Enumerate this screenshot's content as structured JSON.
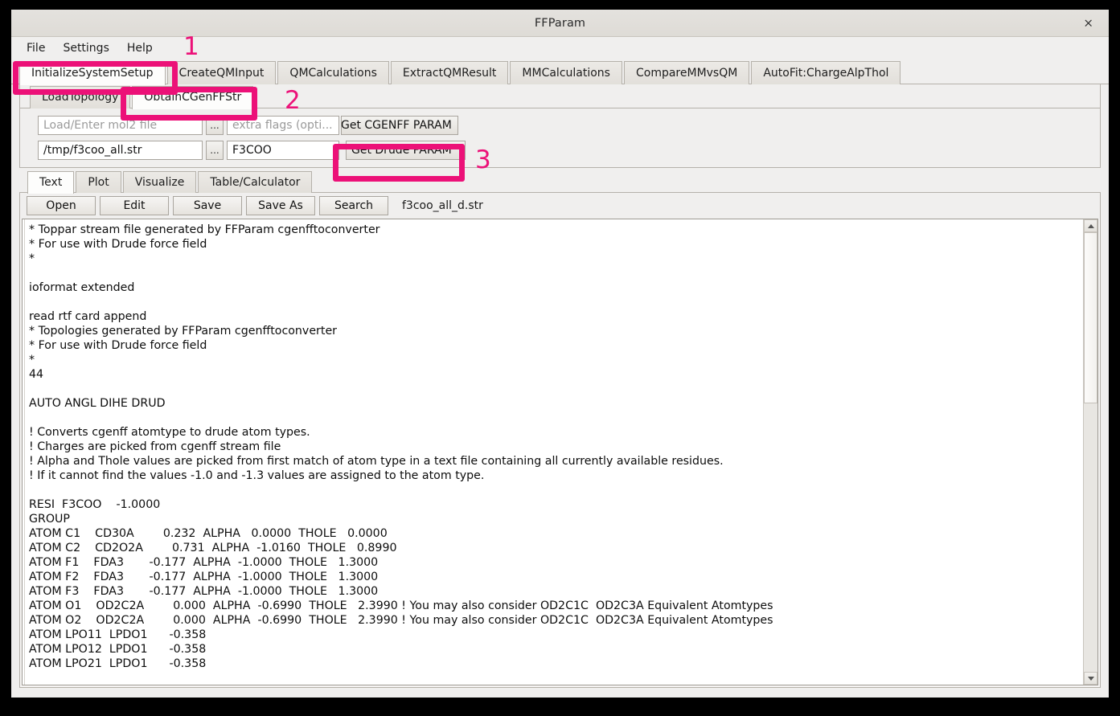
{
  "window": {
    "title": "FFParam",
    "close_label": "×"
  },
  "menubar": {
    "items": [
      {
        "label": "File"
      },
      {
        "label": "Settings"
      },
      {
        "label": "Help"
      }
    ]
  },
  "main_tabs": {
    "active": "InitializeSystemSetup",
    "items": [
      {
        "label": "InitializeSystemSetup"
      },
      {
        "label": "CreateQMInput"
      },
      {
        "label": "QMCalculations"
      },
      {
        "label": "ExtractQMResult"
      },
      {
        "label": "MMCalculations"
      },
      {
        "label": "CompareMMvsQM"
      },
      {
        "label": "AutoFit:ChargeAlpThol"
      }
    ]
  },
  "sub_tabs": {
    "active": "ObtainCGenFFStr",
    "items": [
      {
        "label": "LoadTopology"
      },
      {
        "label": "ObtainCGenFFStr"
      }
    ]
  },
  "param_form": {
    "row1": {
      "mol2_value": "",
      "mol2_placeholder": "Load/Enter mol2 file",
      "browse_label": "...",
      "flags_value": "",
      "flags_placeholder": "extra flags (opti...",
      "action_label": "Get CGENFF PARAM"
    },
    "row2": {
      "str_value": "/tmp/f3coo_all.str",
      "str_placeholder": "",
      "browse_label": "...",
      "resname_value": "F3COO",
      "resname_placeholder": "",
      "action_label": "Get Drude PARAM"
    }
  },
  "editor": {
    "tabs": {
      "active": "Text",
      "items": [
        {
          "label": "Text"
        },
        {
          "label": "Plot"
        },
        {
          "label": "Visualize"
        },
        {
          "label": "Table/Calculator"
        }
      ]
    },
    "toolbar": {
      "buttons": [
        {
          "label": "Open"
        },
        {
          "label": "Edit"
        },
        {
          "label": "Save"
        },
        {
          "label": "Save As"
        },
        {
          "label": "Search"
        }
      ],
      "filename": "f3coo_all_d.str"
    },
    "text": "* Toppar stream file generated by FFParam cgenfftoconverter\n* For use with Drude force field\n*\n\nioformat extended\n\nread rtf card append\n* Topologies generated by FFParam cgenfftoconverter\n* For use with Drude force field\n*\n44\n\nAUTO ANGL DIHE DRUD\n\n! Converts cgenff atomtype to drude atom types.\n! Charges are picked from cgenff stream file\n! Alpha and Thole values are picked from first match of atom type in a text file containing all currently available residues.\n! If it cannot find the values -1.0 and -1.3 values are assigned to the atom type.\n\nRESI  F3COO    -1.0000\nGROUP\nATOM C1    CD30A        0.232  ALPHA   0.0000  THOLE   0.0000\nATOM C2    CD2O2A        0.731  ALPHA  -1.0160  THOLE   0.8990\nATOM F1    FDA3       -0.177  ALPHA  -1.0000  THOLE   1.3000\nATOM F2    FDA3       -0.177  ALPHA  -1.0000  THOLE   1.3000\nATOM F3    FDA3       -0.177  ALPHA  -1.0000  THOLE   1.3000\nATOM O1    OD2C2A        0.000  ALPHA  -0.6990  THOLE   2.3990 ! You may also consider OD2C1C  OD2C3A Equivalent Atomtypes\nATOM O2    OD2C2A        0.000  ALPHA  -0.6990  THOLE   2.3990 ! You may also consider OD2C1C  OD2C3A Equivalent Atomtypes\nATOM LPO11  LPDO1      -0.358\nATOM LPO12  LPDO1      -0.358\nATOM LPO21  LPDO1      -0.358"
  },
  "scrollbar": {
    "up_icon": "triangle-up-icon",
    "down_icon": "triangle-down-icon",
    "thumb_position_pct": 0,
    "thumb_size_pct": 39
  },
  "annotations": {
    "color": "#ec1178",
    "steps": [
      {
        "number": "1"
      },
      {
        "number": "2"
      },
      {
        "number": "3"
      }
    ]
  }
}
